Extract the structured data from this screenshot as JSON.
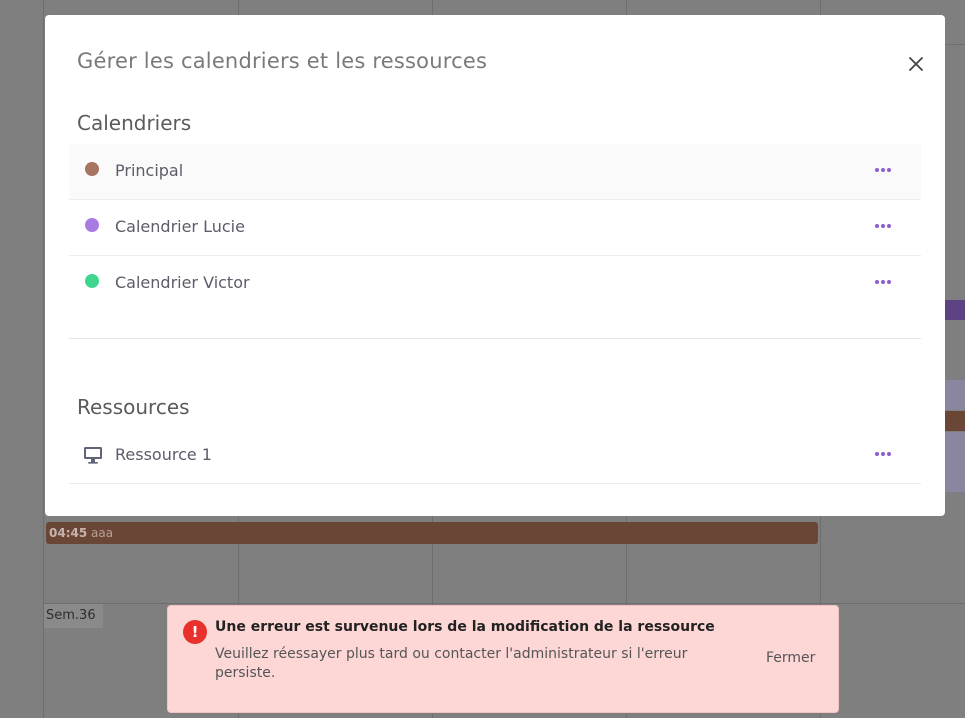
{
  "background": {
    "event": {
      "time": "04:45",
      "title": "aaa"
    },
    "week_label": "Sem.36"
  },
  "modal": {
    "title": "Gérer les calendriers et les ressources",
    "calendars_section": {
      "title": "Calendriers",
      "items": [
        {
          "label": "Principal",
          "color": "#a87462"
        },
        {
          "label": "Calendrier Lucie",
          "color": "#a97ae3"
        },
        {
          "label": "Calendrier Victor",
          "color": "#3ed68f"
        }
      ]
    },
    "resources_section": {
      "title": "Ressources",
      "items": [
        {
          "label": "Ressource 1",
          "icon": "monitor-icon"
        }
      ]
    }
  },
  "toast": {
    "icon": "!",
    "title": "Une erreur est survenue lors de la modification de la ressource",
    "message": "Veuillez réessayer plus tard ou contacter l'administrateur si l'erreur persiste.",
    "close_label": "Fermer"
  },
  "colors": {
    "accent_more": "#8a5fcf",
    "toast_bg": "#fdd7d6",
    "toast_icon": "#e8302c"
  }
}
